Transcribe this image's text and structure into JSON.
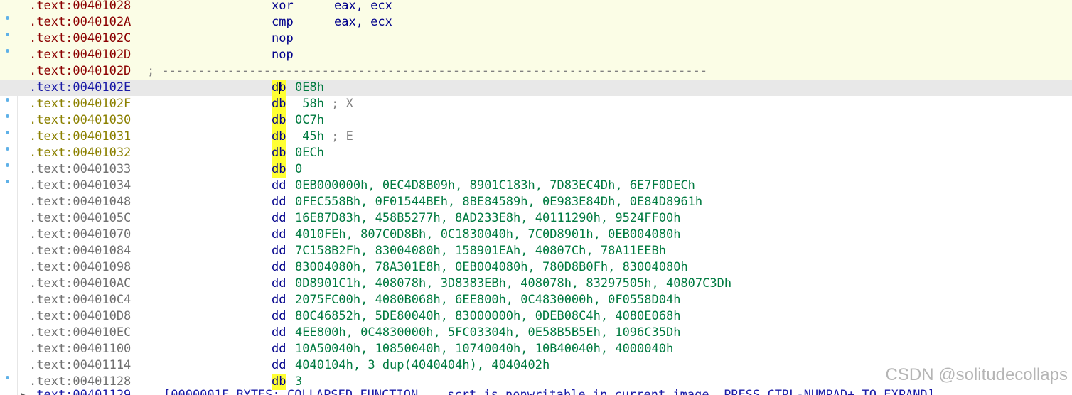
{
  "disasm": {
    "lines": [
      {
        "addr": ".text:00401028",
        "mnem": "xor",
        "ops": "eax, ecx",
        "kind": "code"
      },
      {
        "addr": ".text:0040102A",
        "mnem": "cmp",
        "ops": "eax, ecx",
        "kind": "code"
      },
      {
        "addr": ".text:0040102C",
        "mnem": "nop",
        "ops": "",
        "kind": "code"
      },
      {
        "addr": ".text:0040102D",
        "mnem": "nop",
        "ops": "",
        "kind": "code"
      },
      {
        "addr": ".text:0040102D",
        "separator": "; ---------------------------------------------------------------------------",
        "kind": "code"
      },
      {
        "addr": ".text:0040102E",
        "mnem": "db",
        "ops": "0E8h",
        "comment": "",
        "kind": "current"
      },
      {
        "addr": ".text:0040102F",
        "mnem": "db",
        "ops": " 58h",
        "comment": " ; X",
        "kind": "data"
      },
      {
        "addr": ".text:00401030",
        "mnem": "db",
        "ops": "0C7h",
        "comment": "",
        "kind": "data"
      },
      {
        "addr": ".text:00401031",
        "mnem": "db",
        "ops": " 45h",
        "comment": " ; E",
        "kind": "data"
      },
      {
        "addr": ".text:00401032",
        "mnem": "db",
        "ops": "0ECh",
        "comment": "",
        "kind": "data"
      },
      {
        "addr": ".text:00401033",
        "mnem": "db",
        "ops": "0",
        "comment": "",
        "kind": "plain"
      },
      {
        "addr": ".text:00401034",
        "mnem": "dd",
        "ops": "0EB000000h, 0EC4D8B09h, 8901C183h, 7D83EC4Dh, 6E7F0DECh",
        "kind": "plain"
      },
      {
        "addr": ".text:00401048",
        "mnem": "dd",
        "ops": "0FEC558Bh, 0F01544BEh, 8BE84589h, 0E983E84Dh, 0E84D8961h",
        "kind": "plain"
      },
      {
        "addr": ".text:0040105C",
        "mnem": "dd",
        "ops": "16E87D83h, 458B5277h, 8AD233E8h, 40111290h, 9524FF00h",
        "kind": "plain"
      },
      {
        "addr": ".text:00401070",
        "mnem": "dd",
        "ops": "4010FEh, 807C0D8Bh, 0C1830040h, 7C0D8901h, 0EB004080h",
        "kind": "plain"
      },
      {
        "addr": ".text:00401084",
        "mnem": "dd",
        "ops": "7C158B2Fh, 83004080h, 158901EAh, 40807Ch, 78A11EEBh",
        "kind": "plain"
      },
      {
        "addr": ".text:00401098",
        "mnem": "dd",
        "ops": "83004080h, 78A301E8h, 0EB004080h, 780D8B0Fh, 83004080h",
        "kind": "plain"
      },
      {
        "addr": ".text:004010AC",
        "mnem": "dd",
        "ops": "0D8901C1h, 408078h, 3D8383EBh, 408078h, 83297505h, 40807C3Dh",
        "kind": "plain"
      },
      {
        "addr": ".text:004010C4",
        "mnem": "dd",
        "ops": "2075FC00h, 4080B068h, 6EE800h, 0C4830000h, 0F0558D04h",
        "kind": "plain"
      },
      {
        "addr": ".text:004010D8",
        "mnem": "dd",
        "ops": "80C46852h, 5DE80040h, 83000000h, 0DEB08C4h, 4080E068h",
        "kind": "plain"
      },
      {
        "addr": ".text:004010EC",
        "mnem": "dd",
        "ops": "4EE800h, 0C4830000h, 5FC03304h, 0E58B5B5Eh, 1096C35Dh",
        "kind": "plain"
      },
      {
        "addr": ".text:00401100",
        "mnem": "dd",
        "ops": "10A50040h, 10850040h, 10740040h, 10B40040h, 4000040h",
        "kind": "plain"
      },
      {
        "addr": ".text:00401114",
        "mnem": "dd",
        "ops": "4040104h, 3 dup(4040404h), 4040402h",
        "kind": "plain"
      },
      {
        "addr": ".text:00401128",
        "mnem": "db",
        "ops": "3",
        "comment": "",
        "kind": "plain"
      }
    ],
    "last_line": {
      "addr": ".text:00401129",
      "text": "[0000001F BYTES: COLLAPSED FUNCTION ___scrt_is_nonwritable_in_current_image. PRESS CTRL-NUMPAD+ TO EXPAND]"
    }
  },
  "watermark": "CSDN @solitudecollaps",
  "colors": {
    "address_code": "#8b0000",
    "address_data": "#8b8000",
    "address_current": "#1a1aa6",
    "address_plain": "#707070",
    "mnemonic": "#00008b",
    "data_operand": "#007a40",
    "db_highlight": "#ffff33",
    "code_background": "#fbfde6",
    "current_line_background": "#e8e8e8"
  }
}
